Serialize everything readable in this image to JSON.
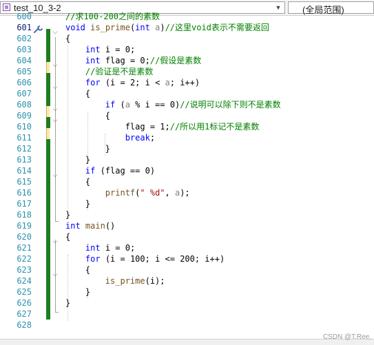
{
  "toolbar": {
    "file_combo": "test_10_3-2",
    "scope_combo": "(全局范围)"
  },
  "editor": {
    "lines": [
      {
        "no": "600",
        "segs": [
          {
            "c": "cm",
            "t": "//求100-200之间的素数"
          }
        ]
      },
      {
        "no": "601",
        "segs": [
          {
            "c": "kw",
            "t": "void"
          },
          {
            "c": "",
            "t": " "
          },
          {
            "c": "fn",
            "t": "is_prime"
          },
          {
            "c": "",
            "t": "("
          },
          {
            "c": "kw",
            "t": "int"
          },
          {
            "c": "",
            "t": " "
          },
          {
            "c": "param",
            "t": "a"
          },
          {
            "c": "",
            "t": ")"
          },
          {
            "c": "cm",
            "t": "//这里void表示不需要返回"
          }
        ]
      },
      {
        "no": "602",
        "segs": [
          {
            "c": "",
            "t": "{"
          }
        ]
      },
      {
        "no": "603",
        "segs": [
          {
            "c": "",
            "t": "    "
          },
          {
            "c": "kw",
            "t": "int"
          },
          {
            "c": "",
            "t": " i = 0;"
          }
        ]
      },
      {
        "no": "604",
        "segs": [
          {
            "c": "",
            "t": "    "
          },
          {
            "c": "kw",
            "t": "int"
          },
          {
            "c": "",
            "t": " flag = 0;"
          },
          {
            "c": "cm",
            "t": "//假设是素数"
          }
        ]
      },
      {
        "no": "605",
        "segs": [
          {
            "c": "",
            "t": "    "
          },
          {
            "c": "cm",
            "t": "//验证是不是素数"
          }
        ]
      },
      {
        "no": "606",
        "segs": [
          {
            "c": "",
            "t": "    "
          },
          {
            "c": "kw",
            "t": "for"
          },
          {
            "c": "",
            "t": " (i = 2; i < "
          },
          {
            "c": "param",
            "t": "a"
          },
          {
            "c": "",
            "t": "; i++)"
          }
        ]
      },
      {
        "no": "607",
        "segs": [
          {
            "c": "",
            "t": "    {"
          }
        ]
      },
      {
        "no": "608",
        "segs": [
          {
            "c": "",
            "t": "        "
          },
          {
            "c": "kw",
            "t": "if"
          },
          {
            "c": "",
            "t": " ("
          },
          {
            "c": "param",
            "t": "a"
          },
          {
            "c": "",
            "t": " % i == 0)"
          },
          {
            "c": "cm",
            "t": "//说明可以除下则不是素数"
          }
        ]
      },
      {
        "no": "609",
        "segs": [
          {
            "c": "",
            "t": "        {"
          }
        ]
      },
      {
        "no": "610",
        "segs": [
          {
            "c": "",
            "t": "            flag = 1;"
          },
          {
            "c": "cm",
            "t": "//所以用1标记不是素数"
          }
        ]
      },
      {
        "no": "611",
        "segs": [
          {
            "c": "",
            "t": "            "
          },
          {
            "c": "kw",
            "t": "break"
          },
          {
            "c": "",
            "t": ";"
          }
        ]
      },
      {
        "no": "612",
        "segs": [
          {
            "c": "",
            "t": "        }"
          }
        ]
      },
      {
        "no": "613",
        "segs": [
          {
            "c": "",
            "t": "    }"
          }
        ]
      },
      {
        "no": "614",
        "segs": [
          {
            "c": "",
            "t": "    "
          },
          {
            "c": "kw",
            "t": "if"
          },
          {
            "c": "",
            "t": " (flag == 0)"
          }
        ]
      },
      {
        "no": "615",
        "segs": [
          {
            "c": "",
            "t": "    {"
          }
        ]
      },
      {
        "no": "616",
        "segs": [
          {
            "c": "",
            "t": "        "
          },
          {
            "c": "fn",
            "t": "printf"
          },
          {
            "c": "",
            "t": "("
          },
          {
            "c": "st",
            "t": "\" %d\""
          },
          {
            "c": "",
            "t": ", "
          },
          {
            "c": "param",
            "t": "a"
          },
          {
            "c": "",
            "t": ");"
          }
        ]
      },
      {
        "no": "617",
        "segs": [
          {
            "c": "",
            "t": "    }"
          }
        ]
      },
      {
        "no": "618",
        "segs": [
          {
            "c": "",
            "t": "}"
          }
        ]
      },
      {
        "no": "619",
        "segs": [
          {
            "c": "kw",
            "t": "int"
          },
          {
            "c": "",
            "t": " "
          },
          {
            "c": "fn",
            "t": "main"
          },
          {
            "c": "",
            "t": "()"
          }
        ]
      },
      {
        "no": "620",
        "segs": [
          {
            "c": "",
            "t": "{"
          }
        ]
      },
      {
        "no": "621",
        "segs": [
          {
            "c": "",
            "t": "    "
          },
          {
            "c": "kw",
            "t": "int"
          },
          {
            "c": "",
            "t": " i = 0;"
          }
        ]
      },
      {
        "no": "622",
        "segs": [
          {
            "c": "",
            "t": "    "
          },
          {
            "c": "kw",
            "t": "for"
          },
          {
            "c": "",
            "t": " (i = 100; i <= 200; i++)"
          }
        ]
      },
      {
        "no": "623",
        "segs": [
          {
            "c": "",
            "t": "    {"
          }
        ]
      },
      {
        "no": "624",
        "segs": [
          {
            "c": "",
            "t": "        "
          },
          {
            "c": "fn",
            "t": "is_prime"
          },
          {
            "c": "",
            "t": "(i);"
          }
        ]
      },
      {
        "no": "625",
        "segs": [
          {
            "c": "",
            "t": "    }"
          }
        ]
      },
      {
        "no": "626",
        "segs": [
          {
            "c": "",
            "t": "}"
          }
        ]
      },
      {
        "no": "627",
        "segs": []
      },
      {
        "no": "628",
        "segs": []
      }
    ],
    "current_line": "601",
    "quick_action_icon": "wrench-icon",
    "colors": {
      "keyword": "#0000ff",
      "comment": "#008000",
      "string": "#a31515",
      "function": "#74531f",
      "line_number": "#2b91af",
      "change_bar": "#1e7d1e"
    }
  },
  "watermark": "CSDN @T.Ree."
}
